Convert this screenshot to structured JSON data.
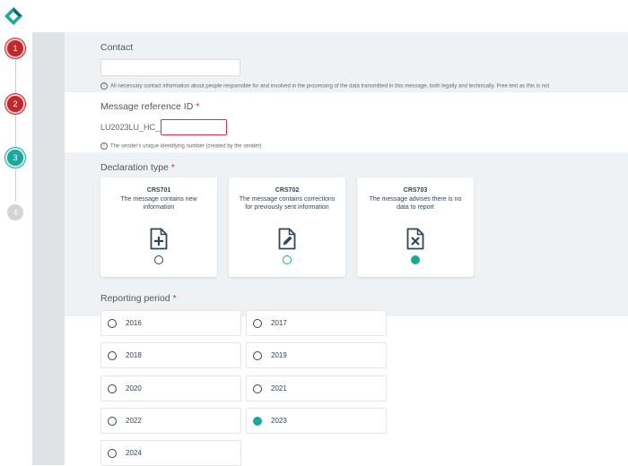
{
  "stepper": {
    "steps": [
      "1",
      "2",
      "3",
      "4"
    ]
  },
  "form": {
    "contact": {
      "label": "Contact",
      "value": "",
      "hint": "All necessary contact information about people responsible for and involved in the processing of the data transmitted in this message, both legally and technically. Free text as this is not"
    },
    "message_ref": {
      "label": "Message reference ID",
      "required_mark": "*",
      "prefix": "LU2023LU_HC__",
      "value": "",
      "hint": "The sender's unique identifying number (created by the sender)"
    },
    "declaration": {
      "label": "Declaration type",
      "required_mark": "*",
      "options": [
        {
          "code": "CRS701",
          "description": "The message contains new information",
          "icon": "file-plus-icon",
          "selected": false
        },
        {
          "code": "CRS702",
          "description": "The message contains corrections for previously sent information",
          "icon": "file-edit-icon",
          "selected": false
        },
        {
          "code": "CRS703",
          "description": "The message advises there is no data to report",
          "icon": "file-x-icon",
          "selected": true
        }
      ]
    },
    "reporting_period": {
      "label": "Reporting period",
      "required_mark": "*",
      "years": [
        "2016",
        "2017",
        "2018",
        "2019",
        "2020",
        "2021",
        "2022",
        "2023",
        "2024"
      ],
      "selected": "2023"
    }
  },
  "colors": {
    "accent": "#1aa89c",
    "error": "#c1272d",
    "text_dark": "#2f4558",
    "band": "#eef2f4"
  }
}
